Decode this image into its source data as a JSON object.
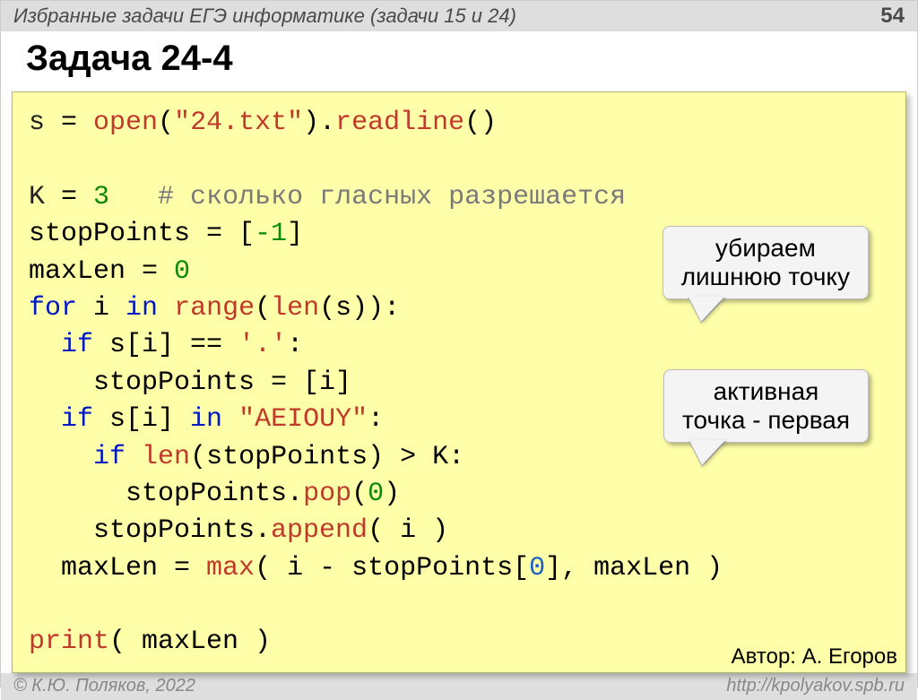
{
  "header": {
    "subtitle": "Избранные задачи ЕГЭ информатике (задачи 15 и 24)",
    "page_number": "54"
  },
  "title": "Задача 24-4",
  "code": {
    "l1_var": "s",
    "l1_eq": " = ",
    "l1_open": "open",
    "l1_par1": "(",
    "l1_str": "\"24.txt\"",
    "l1_par2": ").",
    "l1_readline": "readline",
    "l1_end": "()",
    "blank": "",
    "l2_var": "K",
    "l2_eq": " = ",
    "l2_num": "3",
    "l2_cmt": "   # сколько гласных разрешается",
    "l3_a": "stopPoints = [",
    "l3_num": "-1",
    "l3_b": "]",
    "l4_a": "maxLen = ",
    "l4_num": "0",
    "l5_for": "for",
    "l5_mid": " i ",
    "l5_in": "in",
    "l5_sp": " ",
    "l5_range": "range",
    "l5_paren": "(",
    "l5_len": "len",
    "l5_tail": "(s)):",
    "l6_if": "  if",
    "l6_mid": " s[i] == ",
    "l6_str": "'.'",
    "l6_tail": ":",
    "l7": "    stopPoints = [i]",
    "l8_if": "  if",
    "l8_mid": " s[i] ",
    "l8_in": "in",
    "l8_sp": " ",
    "l8_str": "\"AEIOUY\"",
    "l8_tail": ":",
    "l9_if": "    if",
    "l9_sp": " ",
    "l9_len": "len",
    "l9_tail": "(stopPoints) > K:",
    "l10_a": "      stopPoints.",
    "l10_pop": "pop",
    "l10_b": "(",
    "l10_num": "0",
    "l10_c": ")",
    "l11_a": "    stopPoints.",
    "l11_app": "append",
    "l11_b": "( i )",
    "l12_a": "  maxLen = ",
    "l12_max": "max",
    "l12_b": "( i - stopPoints[",
    "l12_num": "0",
    "l12_c": "], maxLen )",
    "l13_print": "print",
    "l13_tail": "( maxLen )"
  },
  "callouts": {
    "c1_line1": "убираем",
    "c1_line2": "лишнюю точку",
    "c2_line1": "активная",
    "c2_line2": "точка - первая"
  },
  "author_label": "Автор: А. Егоров",
  "footer": {
    "copyright": "© К.Ю. Поляков, 2022",
    "url": "http://kpolyakov.spb.ru"
  }
}
